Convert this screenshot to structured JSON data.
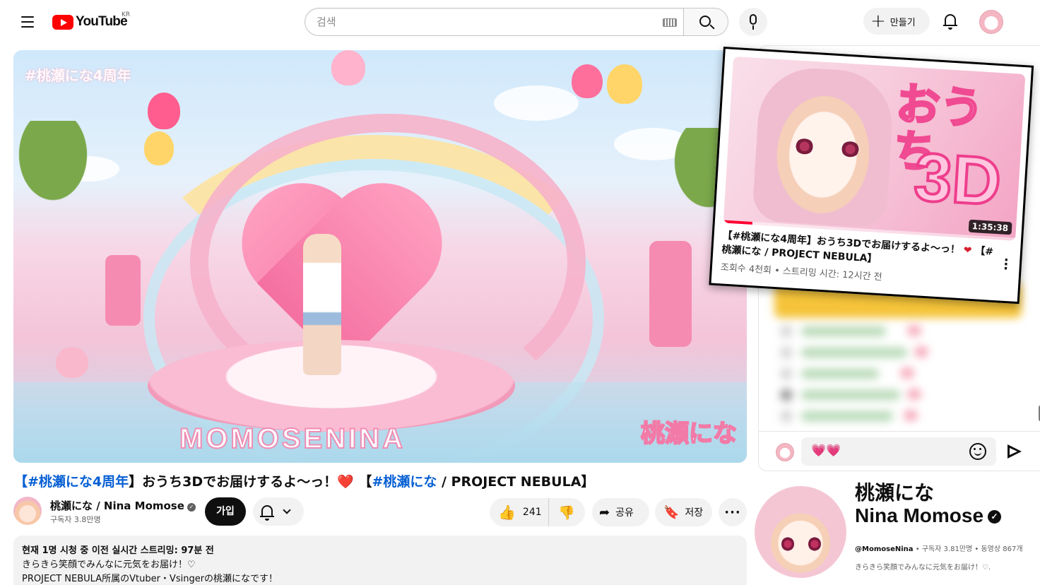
{
  "header": {
    "logo_text": "YouTube",
    "region": "KR",
    "search_placeholder": "검색",
    "create_label": "만들기"
  },
  "video": {
    "overlay_hashtag": "#桃瀬にな4周年",
    "stage_sign": "MOMOSENINA",
    "watermark": "桃瀬にな",
    "title_parts": {
      "tag1": "【#桃瀬にな4周年",
      "mid": "】おうち3Dでお届けするよ〜っ！",
      "heart": "❤️",
      "tag2_open": " 【",
      "tag2": "#桃瀬にな",
      "end": " / PROJECT NEBULA】"
    }
  },
  "owner": {
    "name": "桃瀬にな / Nina Momose",
    "subscribers": "구독자 3.8만명",
    "join_label": "가입"
  },
  "actions": {
    "likes": "241",
    "share_label": "공유",
    "save_label": "저장",
    "more_label": "···"
  },
  "description": {
    "meta": "현재 1명 시청 중  이전 실시간 스트리밍: 97분 전",
    "line1": "きらきら笑顔でみんなに元気をお届け！♡",
    "line2": "PROJECT NEBULA所属のVtuber・Vsingerの桃瀬になです！"
  },
  "chat": {
    "input_value": "💗💗"
  },
  "card": {
    "thumb_text1": "おうち",
    "thumb_text2": "3D",
    "duration": "1:35:38",
    "progress": 0.1,
    "title_part1": "【#桃瀬にな4周年】おうち3Dでお届けするよ〜っ！",
    "heart": "❤",
    "title_part2": "【#桃瀬にな / PROJECT NEBULA】",
    "meta": "조회수 4천회 • 스트리밍 시간: 12시간 전"
  },
  "channel": {
    "name_ja": "桃瀬にな",
    "name_en": "Nina Momose",
    "handle": "@MomoseNina",
    "stats": " • 구독자 3.81만명 • 동영상 867개",
    "description": "きらきら笑顔でみんなに元気をお届け！♡."
  }
}
